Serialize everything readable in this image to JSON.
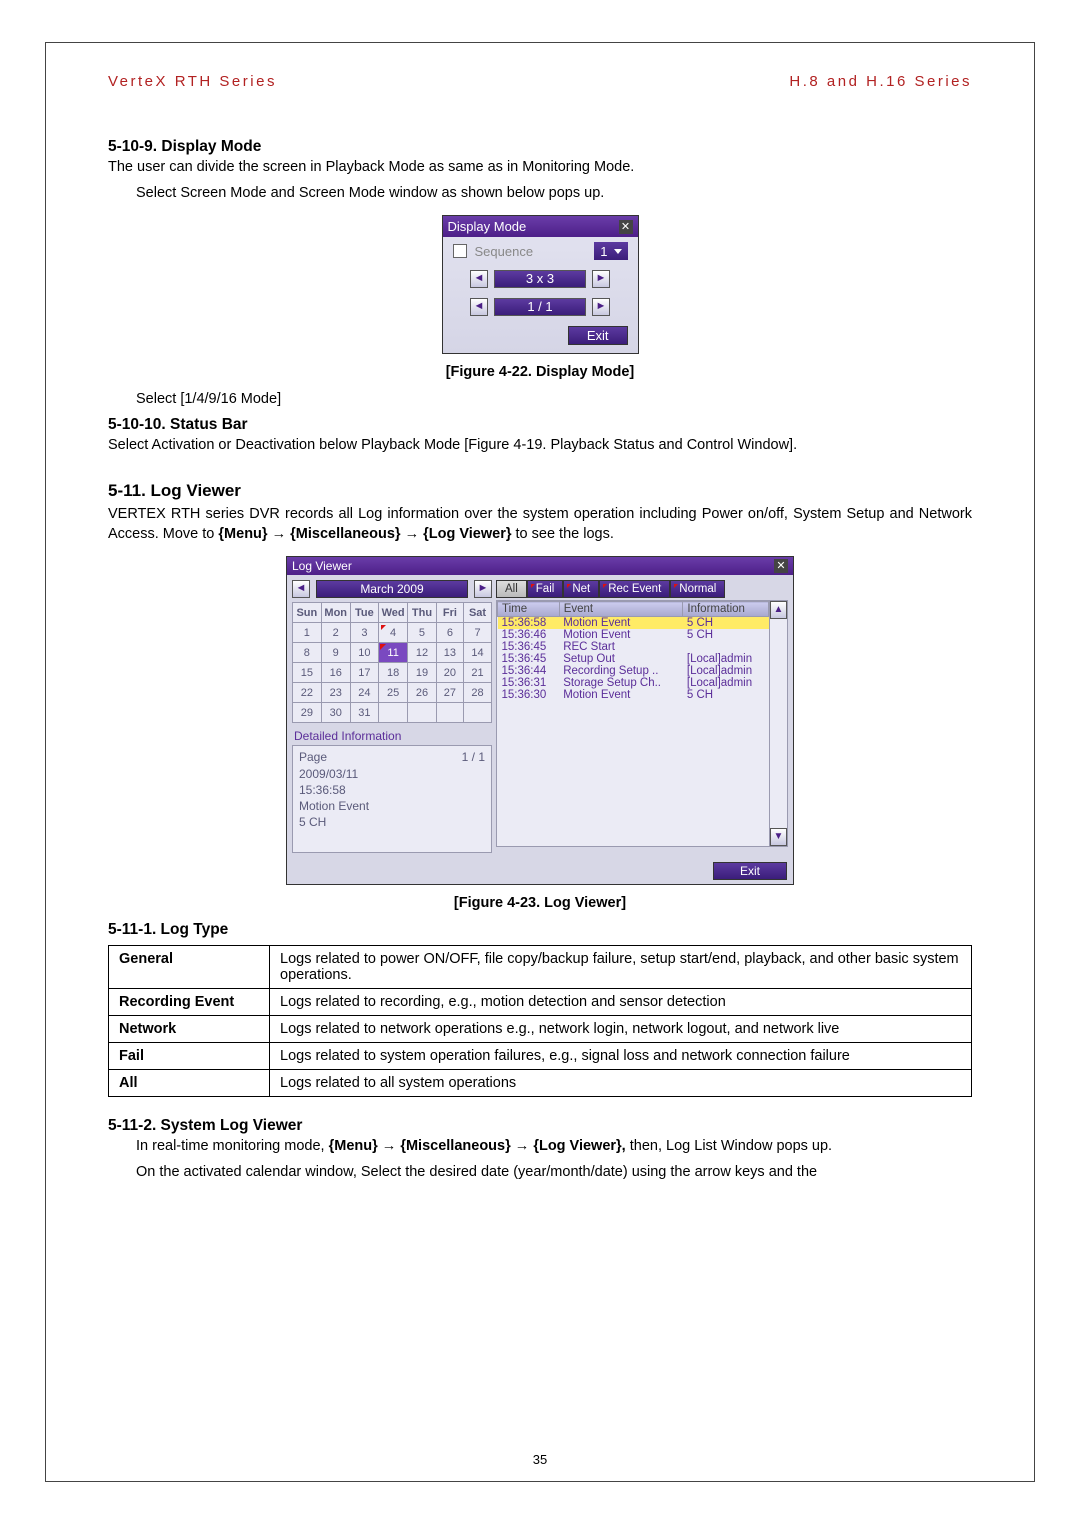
{
  "header": {
    "left": "VerteX RTH Series",
    "right": "H.8 and H.16 Series"
  },
  "sec_display": {
    "heading": "5-10-9.  Display Mode",
    "p1": "The user can divide the screen in Playback Mode as same as in Monitoring Mode.",
    "p2": "Select Screen Mode and Screen Mode window as shown below pops up.",
    "figure_caption": "[Figure 4-22. Display Mode]",
    "after": "Select [1/4/9/16 Mode]"
  },
  "display_dialog": {
    "title": "Display Mode",
    "sequence_label": "Sequence",
    "sequence_value": "1",
    "grid_value": "3 x 3",
    "page_value": "1 / 1",
    "exit": "Exit"
  },
  "sec_statusbar": {
    "heading": "5-10-10.  Status Bar",
    "p": "Select Activation or Deactivation below Playback Mode [Figure 4-19. Playback Status and Control Window]."
  },
  "sec_logviewer": {
    "heading": "5-11.  Log Viewer",
    "p1": "VERTEX RTH series DVR records all Log information over the system operation including Power on/off, System Setup and Network Access. Move to ",
    "nav1": "{Menu}",
    "nav2": "{Miscellaneous}",
    "nav3": "{Log Viewer}",
    "p1_tail": " to see the logs.",
    "figure_caption": "[Figure 4-23. Log Viewer]"
  },
  "log_dialog": {
    "title": "Log Viewer",
    "month": "March 2009",
    "dow": [
      "Sun",
      "Mon",
      "Tue",
      "Wed",
      "Thu",
      "Fri",
      "Sat"
    ],
    "weeks": [
      [
        "1",
        "2",
        "3",
        "4",
        "5",
        "6",
        "7"
      ],
      [
        "8",
        "9",
        "10",
        "11",
        "12",
        "13",
        "14"
      ],
      [
        "15",
        "16",
        "17",
        "18",
        "19",
        "20",
        "21"
      ],
      [
        "22",
        "23",
        "24",
        "25",
        "26",
        "27",
        "28"
      ],
      [
        "29",
        "30",
        "31",
        "",
        "",
        "",
        ""
      ]
    ],
    "detail_title": "Detailed Information",
    "detail_page_label": "Page",
    "detail_page_value": "1 / 1",
    "detail_lines": [
      "2009/03/11",
      "15:36:58",
      "Motion Event",
      " 5 CH"
    ],
    "tabs": [
      "All",
      "Fail",
      "Net",
      "Rec Event",
      "Normal"
    ],
    "list_headers": [
      "Time",
      "Event",
      "Information"
    ],
    "list_rows": [
      {
        "time": "15:36:58",
        "event": "Motion Event",
        "info": "5 CH",
        "selected": true
      },
      {
        "time": "15:36:46",
        "event": "Motion Event",
        "info": "5 CH"
      },
      {
        "time": "15:36:45",
        "event": "REC Start",
        "info": ""
      },
      {
        "time": "15:36:45",
        "event": "Setup Out",
        "info": "[Local]admin"
      },
      {
        "time": "15:36:44",
        "event": "Recording Setup ..",
        "info": "[Local]admin"
      },
      {
        "time": "15:36:31",
        "event": "Storage Setup Ch..",
        "info": "[Local]admin"
      },
      {
        "time": "15:36:30",
        "event": "Motion Event",
        "info": "5 CH"
      }
    ],
    "exit": "Exit"
  },
  "sec_logtype": {
    "heading": "5-11-1.  Log Type",
    "rows": [
      {
        "label": "General",
        "desc": "Logs related to power ON/OFF, file copy/backup failure, setup start/end, playback, and other basic system operations."
      },
      {
        "label": "Recording Event",
        "desc": "Logs related to recording, e.g., motion detection and sensor detection"
      },
      {
        "label": "Network",
        "desc": "Logs related to network operations e.g., network login, network logout, and network live"
      },
      {
        "label": "Fail",
        "desc": "Logs related to system operation failures, e.g., signal loss and network connection failure"
      },
      {
        "label": "All",
        "desc": "Logs related to all system operations"
      }
    ]
  },
  "sec_syslog": {
    "heading": "5-11-2.  System Log Viewer",
    "p1a": "In real-time monitoring mode, ",
    "nav1": "{Menu}",
    "nav2": "{Miscellaneous}",
    "nav3": "{Log Viewer},",
    "p1b": " then, Log List Window pops up.",
    "p2": "On the activated calendar window, Select the desired date (year/month/date) using the arrow keys and the"
  },
  "page_number": "35"
}
